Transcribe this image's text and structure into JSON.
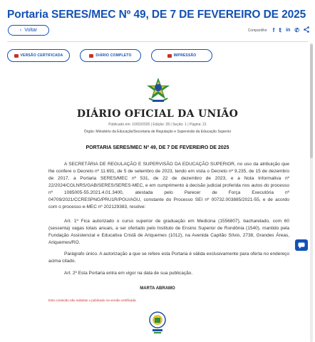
{
  "header": {
    "title": "Portaria SERES/MEC Nº 49, DE 7 DE FEVEREIRO DE 2025",
    "back_label": "Voltar",
    "share_label": "Compartilhe",
    "share_icons": [
      "facebook-icon",
      "twitter-icon",
      "linkedin-icon",
      "whatsapp-icon",
      "share-icon"
    ]
  },
  "actions": {
    "certified_label": "VERSÃO CERTIFICADA",
    "full_label": "DIÁRIO COMPLETO",
    "print_label": "IMPRESSÃO"
  },
  "document": {
    "masthead": "DIÁRIO OFICIAL DA UNIÃO",
    "published": "Publicado em: 10/02/2025 | Edição: 28 | Seção: 1 | Página: 21",
    "organ": "Órgão: Ministério da Educação/Secretaria de Regulação e Supervisão da Educação Superior",
    "act_title": "PORTARIA SERES/MEC Nº 49, DE 7 DE FEVEREIRO DE 2025",
    "paragraph1": "A SECRETÁRIA DE REGULAÇÃO E SUPERVISÃO DA EDUCAÇÃO SUPERIOR, no uso da atribuição que lhe confere o Decreto nº 11.691, de 5 de setembro de 2023, tendo em vista o Decreto nº 9.235, de 15 de dezembro de 2017, a Portaria SERES/MEC nº 531, de 22 de dezembro de 2023, e a Nota Informativa nº 22/2024/CGLNRS/GAB/SERES/SERES-MEC, e em cumprimento à decisão judicial proferida nos autos do processo nº 1085005-55.2021.4.01.3400, atestada pelo Parecer de Força Executória nº 04709/2021/CCRESPNG/PRU1R/PGU/AGU, constante do Processo SEI nº 00732.003885/2021-55, e de acordo com o processo e-MEC nº 202129383, resolve:",
    "paragraph2": "Art. 1º Fica autorizado o curso superior de graduação em Medicina (1556807), bacharelado, com 60 (sessenta) vagas totais anuais, a ser ofertado pelo Instituto de Ensino Superior de Rondônia (1540), mantido pela Fundação Assistencial e Educativa Cristã de Ariquemes (1012), na Avenida Capitão Sílvio, 2738, Grandes Áreas, Ariquemes/RO.",
    "paragraph3": "Parágrafo único. A autorização a que se refere esta Portaria é válida exclusivamente para oferta no endereço acima citado.",
    "paragraph4": "Art. 2º Esta Portaria entra em vigor na data de sua publicação.",
    "signer": "MARTA ABRAMO",
    "note": "Este conteúdo não substitui o publicado na versão certificada."
  },
  "colors": {
    "primary": "#1351b4",
    "alert": "#c9302c"
  }
}
